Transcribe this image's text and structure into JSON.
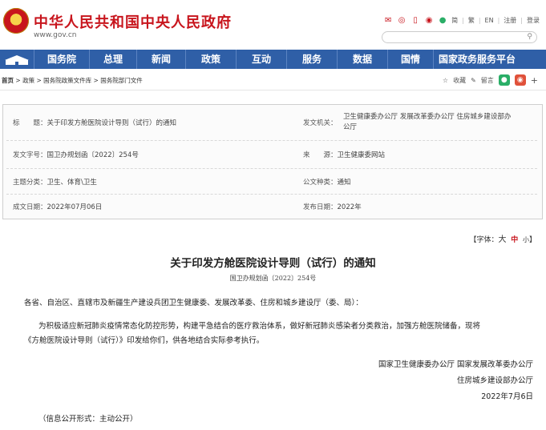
{
  "header": {
    "site_title": "中华人民共和国中央人民政府",
    "site_url": "www.gov.cn",
    "links": [
      "简",
      "繁",
      "EN",
      "注册",
      "登录"
    ],
    "icons": [
      "mail-icon",
      "weibo-icon",
      "phone-icon",
      "weibo-icon",
      "wechat-icon"
    ]
  },
  "nav": {
    "items": [
      "国务院",
      "总理",
      "新闻",
      "政策",
      "互动",
      "服务",
      "数据",
      "国情",
      "国家政务服务平台"
    ]
  },
  "breadcrumb": {
    "items": [
      "首页",
      "政策",
      "国务院政策文件库",
      "国务院部门文件"
    ],
    "separator": ">",
    "collect_label": "收藏",
    "comment_label": "留言"
  },
  "info": {
    "title_label": "标　　题：",
    "title_value": "关于印发方舱医院设计导则（试行）的通知",
    "issuer_label": "发文机关：",
    "issuer_value_line1": "卫生健康委办公厅 发展改革委办公厅 住房城乡建设部办",
    "issuer_value_line2": "公厅",
    "docno_label": "发文字号：",
    "docno_value": "国卫办规划函〔2022〕254号",
    "source_label": "来　　源：",
    "source_value": "卫生健康委网站",
    "topic_label": "主题分类：",
    "topic_value": "卫生、体育\\卫生",
    "type_label": "公文种类：",
    "type_value": "通知",
    "written_label": "成文日期：",
    "written_value": "2022年07月06日",
    "published_label": "发布日期：",
    "published_value": "2022年"
  },
  "fontsize": {
    "prefix": "【字体：",
    "large": "大",
    "medium": "中",
    "small": "小",
    "suffix": "】"
  },
  "document": {
    "title": "关于印发方舱医院设计导则（试行）的通知",
    "doc_no": "国卫办规划函〔2022〕254号",
    "addressee": "各省、自治区、直辖市及新疆生产建设兵团卫生健康委、发展改革委、住房和城乡建设厅（委、局）：",
    "body_line1": "为积极适应新冠肺炎疫情常态化防控形势，构建平急结合的医疗救治体系，做好新冠肺炎感染者分类救治，加强方舱医院储备，现将",
    "body_line2": "《方舱医院设计导则（试行）》印发给你们，供各地结合实际参考执行。",
    "signer_line1": "国家卫生健康委办公厅 国家发展改革委办公厅",
    "signer_line2": "住房城乡建设部办公厅",
    "date": "2022年7月6日",
    "disclosure": "（信息公开形式：主动公开）"
  },
  "colors": {
    "brand_red": "#c8151d",
    "nav_blue": "#2f5fa7"
  }
}
